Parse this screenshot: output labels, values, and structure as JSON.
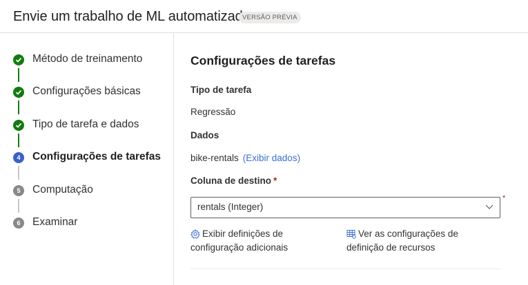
{
  "header": {
    "title": "Envie um trabalho de ML automatizado",
    "badge": "VERSÃO PRÉVIA"
  },
  "steps": [
    {
      "number": "1",
      "label": "Método de treinamento",
      "status": "complete"
    },
    {
      "number": "2",
      "label": "Configurações básicas",
      "status": "complete"
    },
    {
      "number": "3",
      "label": "Tipo de tarefa e dados",
      "status": "complete"
    },
    {
      "number": "4",
      "label": "Configurações de tarefas",
      "status": "current"
    },
    {
      "number": "5",
      "label": "Computação",
      "status": "pending"
    },
    {
      "number": "6",
      "label": "Examinar",
      "status": "pending"
    }
  ],
  "main": {
    "section_title": "Configurações de tarefas",
    "task_type_label": "Tipo de tarefa",
    "task_type_value": "Regressão",
    "data_label": "Dados",
    "data_value": "bike-rentals",
    "data_link": "(Exibir dados)",
    "target_label": "Coluna de destino",
    "required_mark": "*",
    "target_value": "rentals (Integer)",
    "action_left_line1": "Exibir definições de",
    "action_left_line2": "configuração adicionais",
    "action_right_line1": "Ver as configurações de",
    "action_right_line2": "definição de recursos"
  },
  "colors": {
    "complete": "#107c10",
    "current": "#3a5fcd",
    "pending": "#8a8886",
    "link": "#3b6fd0",
    "required": "#a4262c"
  },
  "icons": {
    "step_complete": "checkmark-icon",
    "select_chevron": "chevron-down-icon",
    "action_left": "gear-icon",
    "action_right": "table-settings-icon"
  }
}
